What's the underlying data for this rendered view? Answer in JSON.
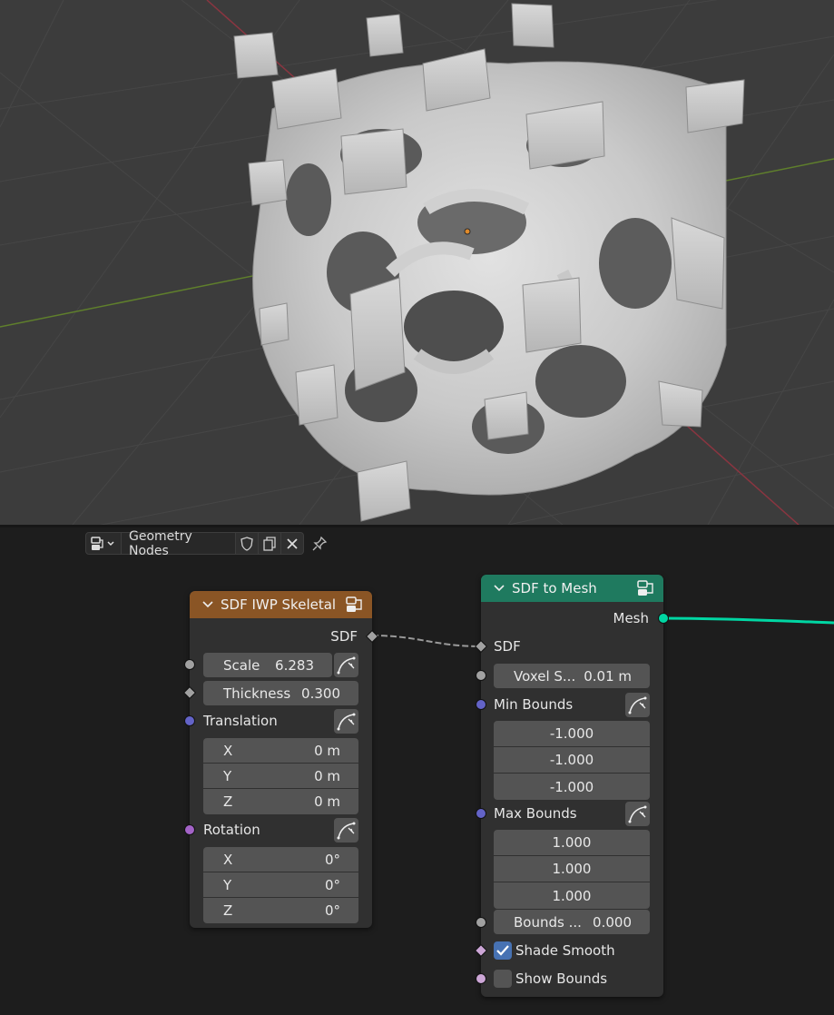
{
  "viewport": {
    "background": "#3c3c3c",
    "object": "gyroid-lattice-mesh"
  },
  "editor_header": {
    "tree_name": "Geometry Nodes",
    "icons": [
      "node-tree-icon",
      "chevron-down-icon",
      "shield-icon",
      "copy-icon",
      "close-icon",
      "pin-icon"
    ]
  },
  "node_iwp": {
    "title": "SDF IWP Skeletal",
    "header_color": "#8a5525",
    "output_label": "SDF",
    "scale_label": "Scale",
    "scale_value": "6.283",
    "thickness_label": "Thickness",
    "thickness_value": "0.300",
    "translation_label": "Translation",
    "translation": [
      {
        "axis": "X",
        "value": "0 m"
      },
      {
        "axis": "Y",
        "value": "0 m"
      },
      {
        "axis": "Z",
        "value": "0 m"
      }
    ],
    "rotation_label": "Rotation",
    "rotation": [
      {
        "axis": "X",
        "value": "0°"
      },
      {
        "axis": "Y",
        "value": "0°"
      },
      {
        "axis": "Z",
        "value": "0°"
      }
    ]
  },
  "node_mesh": {
    "title": "SDF to Mesh",
    "header_color": "#1f7a5f",
    "output_label": "Mesh",
    "sdf_label": "SDF",
    "voxel_label": "Voxel S...",
    "voxel_value": "0.01 m",
    "min_bounds_label": "Min Bounds",
    "min_bounds": [
      "-1.000",
      "-1.000",
      "-1.000"
    ],
    "max_bounds_label": "Max Bounds",
    "max_bounds": [
      "1.000",
      "1.000",
      "1.000"
    ],
    "bounds_label": "Bounds ...",
    "bounds_value": "0.000",
    "shade_smooth_label": "Shade Smooth",
    "shade_smooth_checked": true,
    "show_bounds_label": "Show Bounds",
    "show_bounds_checked": false
  },
  "colors": {
    "socket_float": "#a1a1a1",
    "socket_vector": "#6363c7",
    "socket_rotation": "#a363c7",
    "socket_geometry": "#00d6a3",
    "socket_bool": "#cca6d6",
    "link_geometry": "#00d6a3",
    "checkbox_on": "#4772b3"
  }
}
